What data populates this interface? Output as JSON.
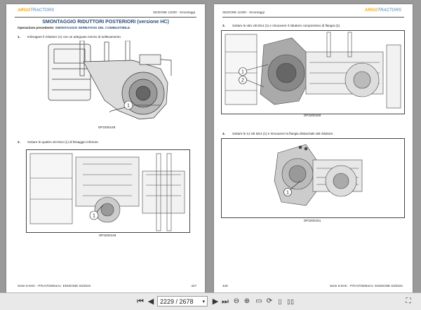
{
  "left_page": {
    "logo": {
      "brand": "ARGO",
      "suffix": "TRACTORS"
    },
    "section": "SEZIONE 11000 - Smontaggi",
    "title": "SMONTAGGIO RIDUTTORI POSTERIORI (versione HC)",
    "prev_op_label": "Operazione precedente:",
    "prev_op_value": "SMONTAGGIO SERBATOIO DEL COMBUSTIBILE.",
    "steps": [
      {
        "num": "1.",
        "text": "Imbragare il riduttore (1) con un adeguato mezzo di sollevamento."
      },
      {
        "num": "2.",
        "text": "Svitare le quattro viti M14 (1) di fissaggio inferiore."
      }
    ],
    "figures": [
      {
        "caption": "OP2200148",
        "callouts": [
          "1"
        ]
      },
      {
        "caption": "OP2200149",
        "callouts": [
          "1"
        ]
      }
    ],
    "footer_left": "Serie 5-5HC - P/N 6703064A1- EDIZIONE 03/2022",
    "footer_right": "427"
  },
  "right_page": {
    "logo": {
      "brand": "ARGO",
      "suffix": "TRACTORS"
    },
    "section": "SEZIONE 11000 - Smontaggi",
    "steps": [
      {
        "num": "3.",
        "text": "Svitare le otto viti M14 (1) e rimuovere il riduttore comprensivo di flangia (2)."
      },
      {
        "num": "4.",
        "text": "Svitare le 12 viti M14 (1) e rimuovere la flangia distanziale dal riduttore."
      }
    ],
    "figures": [
      {
        "caption": "OP2200150",
        "callouts": [
          "1",
          "2"
        ]
      },
      {
        "caption": "OP2200151",
        "callouts": [
          "1"
        ]
      }
    ],
    "footer_left": "428",
    "footer_right": "Serie 5-5HC - P/N 6703064A1- EDIZIONE 03/2022"
  },
  "toolbar": {
    "page_indicator": "2229 / 2678",
    "buttons": [
      "first-page",
      "prev-page",
      "next-page",
      "last-page",
      "zoom-out",
      "zoom-in",
      "fit-page",
      "rotate",
      "single-page",
      "two-page",
      "fullscreen"
    ]
  },
  "colors": {
    "title_blue": "#2a4d7a",
    "logo_orange": "#f7a600",
    "toolbar_bg": "#e9e9e9",
    "viewer_bg": "#9a9a9a"
  }
}
